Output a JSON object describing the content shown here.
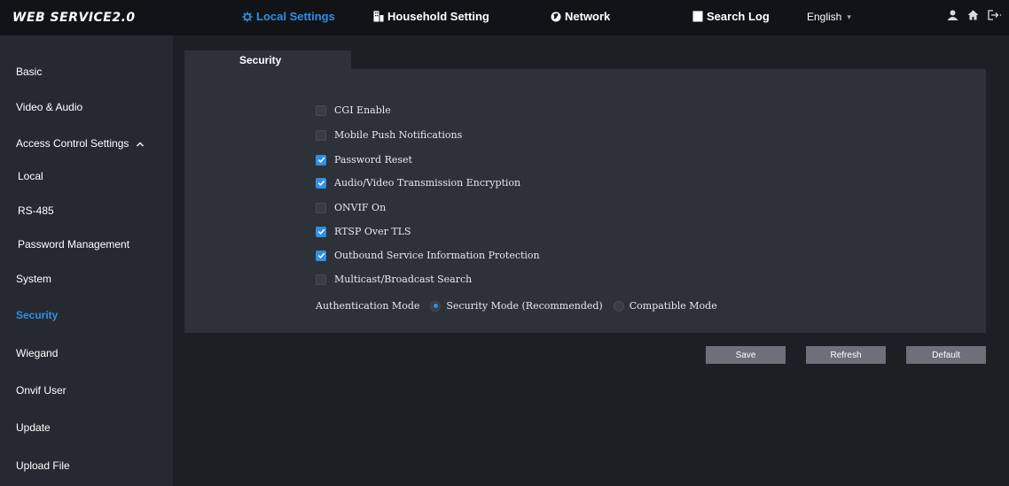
{
  "app": {
    "logo": "WEB SERVICE2.0"
  },
  "nav": {
    "local_settings": "Local Settings",
    "household": "Household Setting",
    "network": "Network",
    "search_log": "Search Log",
    "language": "English"
  },
  "sidebar": {
    "items": [
      {
        "label": "Basic"
      },
      {
        "label": "Video & Audio"
      },
      {
        "label": "Access Control Settings"
      },
      {
        "label": "Local"
      },
      {
        "label": "RS-485"
      },
      {
        "label": "Password Management"
      },
      {
        "label": "System"
      },
      {
        "label": "Security"
      },
      {
        "label": "Wiegand"
      },
      {
        "label": "Onvif User"
      },
      {
        "label": "Update"
      },
      {
        "label": "Upload File"
      }
    ]
  },
  "tab": {
    "label": "Security"
  },
  "options": [
    {
      "label": "CGI Enable",
      "checked": false
    },
    {
      "label": "Mobile Push Notifications",
      "checked": false
    },
    {
      "label": "Password Reset",
      "checked": true
    },
    {
      "label": "Audio/Video Transmission Encryption",
      "checked": true
    },
    {
      "label": "ONVIF On",
      "checked": false
    },
    {
      "label": "RTSP Over TLS",
      "checked": true
    },
    {
      "label": "Outbound Service Information Protection",
      "checked": true
    },
    {
      "label": "Multicast/Broadcast Search",
      "checked": false
    }
  ],
  "auth": {
    "label": "Authentication Mode",
    "security_mode": "Security Mode (Recommended)",
    "compatible_mode": "Compatible Mode",
    "selected": "Security Mode (Recommended)"
  },
  "buttons": {
    "save": "Save",
    "refresh": "Refresh",
    "default": "Default"
  },
  "colors": {
    "accent": "#2f8fe6",
    "background": "#1c1f24",
    "panel": "#2d3138",
    "button": "#6b7079"
  }
}
